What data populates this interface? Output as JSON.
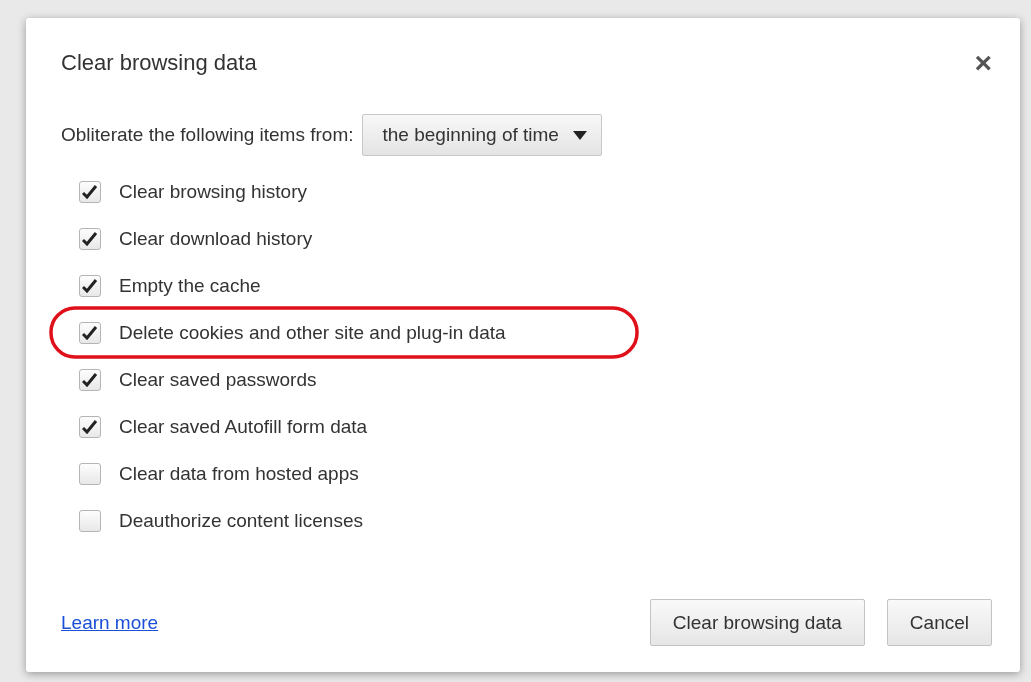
{
  "dialog": {
    "title": "Clear browsing data",
    "close": "×"
  },
  "range": {
    "label": "Obliterate the following items from:",
    "value": "the beginning of time"
  },
  "items": [
    {
      "label": "Clear browsing history",
      "checked": true,
      "highlighted": false
    },
    {
      "label": "Clear download history",
      "checked": true,
      "highlighted": false
    },
    {
      "label": "Empty the cache",
      "checked": true,
      "highlighted": false
    },
    {
      "label": "Delete cookies and other site and plug-in data",
      "checked": true,
      "highlighted": true
    },
    {
      "label": "Clear saved passwords",
      "checked": true,
      "highlighted": false
    },
    {
      "label": "Clear saved Autofill form data",
      "checked": true,
      "highlighted": false
    },
    {
      "label": "Clear data from hosted apps",
      "checked": false,
      "highlighted": false
    },
    {
      "label": "Deauthorize content licenses",
      "checked": false,
      "highlighted": false
    }
  ],
  "footer": {
    "link": "Learn more",
    "buttons": [
      "Clear browsing data",
      "Cancel"
    ]
  }
}
